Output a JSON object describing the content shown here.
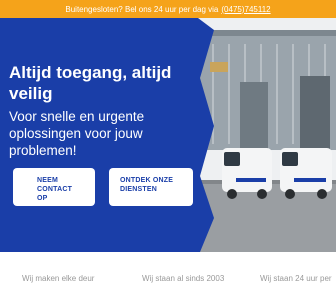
{
  "topbar": {
    "text": "Buitengesloten? Bel ons 24 uur per dag via",
    "phone": "(0475)745112"
  },
  "hero": {
    "headline": "Altijd toegang, altijd veilig",
    "subline": "Voor snelle en urgente oplossingen voor jouw problemen!",
    "buttons": [
      {
        "label": "NEEM CONTACT OP"
      },
      {
        "label": "ONTDEK ONZE DIENSTEN"
      }
    ]
  },
  "features": [
    {
      "text": "Wij maken elke deur"
    },
    {
      "text": "Wij staan al sinds 2003"
    },
    {
      "text": "Wij staan 24 uur per"
    }
  ],
  "colors": {
    "brand_blue": "#1a3ea8",
    "accent_orange": "#f5a31a"
  },
  "icons": [
    "van-icon"
  ]
}
